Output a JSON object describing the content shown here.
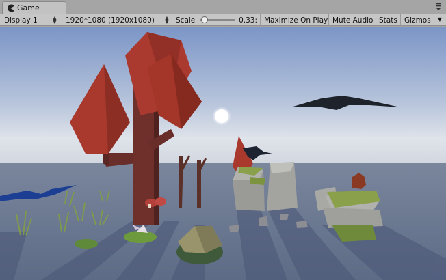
{
  "window": {
    "tab_label": "Game",
    "tab_icon": "pacman-icon",
    "menu_icon": "window-menu-icon"
  },
  "toolbar": {
    "display_label": "Display 1",
    "resolution_label": "1920*1080 (1920x1080)",
    "scale_label": "Scale",
    "scale_value": "0.33",
    "scale_value_display": "0.33:",
    "scale_level_fraction": 0.05,
    "maximize_label": "Maximize On Play",
    "mute_label": "Mute Audio",
    "stats_label": "Stats",
    "gizmos_label": "Gizmos"
  },
  "scene": {
    "description_name": "low-poly-forest-scene",
    "colors": {
      "sky_top": "#7d97c8",
      "sky_horizon": "#d8dee8",
      "ground": "#6a7893",
      "foliage": "#a9392d",
      "trunk": "#6a2e2a",
      "bird": "#1e222b",
      "blue_bird": "#1d3f93"
    }
  }
}
